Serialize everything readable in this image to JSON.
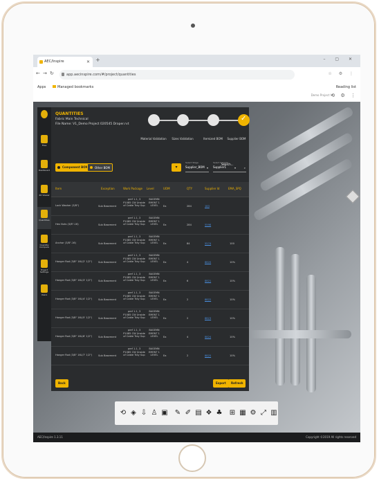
{
  "browser": {
    "tab_title": "AEC/Inspire",
    "url": "app.aecinspire.com/#/project/quantities",
    "bookmarks": {
      "apps": "Apps",
      "managed": "Managed bookmarks",
      "reading_list": "Reading list"
    }
  },
  "app": {
    "project_label": "Demo Project V1",
    "sidebar": [
      {
        "label": "Files",
        "icon": "files-icon"
      },
      {
        "label": "Dashboard",
        "icon": "dashboard-icon"
      },
      {
        "label": "2D Viewer",
        "icon": "viewer-2d-icon"
      },
      {
        "label": "Quantities",
        "icon": "quantities-icon"
      },
      {
        "label": "Quantity Compare",
        "icon": "compare-icon"
      },
      {
        "label": "Project Settings",
        "icon": "settings-icon"
      },
      {
        "label": "Users",
        "icon": "users-icon"
      }
    ],
    "status": {
      "version": "AEC/Inspire 1.3.11",
      "copyright": "Copyright ©2019  All rights reserved"
    }
  },
  "panel": {
    "title": "QUANTITIES",
    "subtitle": "Fabric Main Technical",
    "file_name": "File Name: V1_Demo Project 020545 Draper.rvt",
    "steps": [
      {
        "label": "Material Validation",
        "done": false
      },
      {
        "label": "Sizes Validation",
        "done": false
      },
      {
        "label": "Itemized BOM",
        "done": false
      },
      {
        "label": "Supplier BOM",
        "done": true
      }
    ],
    "tabs": {
      "component": "Component BOM",
      "other": "Other BOM"
    },
    "filters": [
      {
        "label": "Select Stage",
        "value": "Supplier_BOM"
      },
      {
        "label": "Select Supplier",
        "value": "Supplier1"
      },
      {
        "label": "",
        "value": "Search..."
      }
    ],
    "columns": [
      "Item",
      "Exception",
      "Work Package",
      "Level",
      "UOM",
      "QTY",
      "Supplier Id",
      "EMA_SPQ"
    ],
    "rows": [
      {
        "item": "Lock Washer (3/8\")",
        "exception": "Sub Basement",
        "wp": [
          "pref 1.1, 3",
          "P1085 CW (Inside",
          "of Cable Tray Sup"
        ],
        "level": [
          "BASEMN",
          "EMENT 1",
          "LEVEL"
        ],
        "uom": "Ea",
        "qty": "284",
        "supplier": "183",
        "spq": ""
      },
      {
        "item": "Hex Nuts (3/8\"-16)",
        "exception": "Sub Basement",
        "wp": [
          "pref 1.1, 3",
          "P1085 CW (Inside",
          "of Cable Tray Sup"
        ],
        "level": [
          "BASEMN",
          "EMENT 1",
          "LEVEL"
        ],
        "uom": "Ea",
        "qty": "284",
        "supplier": "5598",
        "spq": ""
      },
      {
        "item": "Anchor (3/8\"-16)",
        "exception": "Sub Basement",
        "wp": [
          "pref 1.1, 3",
          "P1085 CW (Inside",
          "of Cable Tray Sup"
        ],
        "level": [
          "BASEMN",
          "EMENT 1",
          "LEVEL"
        ],
        "uom": "Ea",
        "qty": "84",
        "supplier": "5574",
        "spq": "100"
      },
      {
        "item": "Hanger Rod (3/8\" 16L/2' 1/2\")",
        "exception": "Sub Basement",
        "wp": [
          "pref 1.1, 3",
          "P1085 CW (Inside",
          "of Cable Tray Sup"
        ],
        "level": [
          "BASEMN",
          "EMENT 1",
          "LEVEL"
        ],
        "uom": "Ea",
        "qty": "4",
        "supplier": "8820",
        "spq": "10%"
      },
      {
        "item": "Hanger Rod (3/8\" 16L/3' 1/2\")",
        "exception": "Sub Basement",
        "wp": [
          "pref 1.1, 3",
          "P1085 CW (Inside",
          "of Cable Tray Sup"
        ],
        "level": [
          "BASEMN",
          "EMENT 1",
          "LEVEL"
        ],
        "uom": "Ea",
        "qty": "6",
        "supplier": "8821",
        "spq": "10%"
      },
      {
        "item": "Hanger Rod (3/8\" 16L/4' 1/2\")",
        "exception": "Sub Basement",
        "wp": [
          "pref 1.1, 3",
          "P1085 CW (Inside",
          "of Cable Tray Sup"
        ],
        "level": [
          "BASEMN",
          "EMENT 1",
          "LEVEL"
        ],
        "uom": "Ea",
        "qty": "2",
        "supplier": "8822",
        "spq": "10%"
      },
      {
        "item": "Hanger Rod (3/8\" 16L/5' 1/2\")",
        "exception": "Sub Basement",
        "wp": [
          "pref 1.1, 3",
          "P1085 CW (Inside",
          "of Cable Tray Sup"
        ],
        "level": [
          "BASEMN",
          "EMENT 1",
          "LEVEL"
        ],
        "uom": "Ea",
        "qty": "2",
        "supplier": "8823",
        "spq": "10%"
      },
      {
        "item": "Hanger Rod (3/8\" 16L/6' 1/2\")",
        "exception": "Sub Basement",
        "wp": [
          "pref 1.1, 3",
          "P1085 CW (Inside",
          "of Cable Tray Sup"
        ],
        "level": [
          "BASEMN",
          "EMENT 1",
          "LEVEL"
        ],
        "uom": "Ea",
        "qty": "4",
        "supplier": "8824",
        "spq": "10%"
      },
      {
        "item": "Hanger Rod (3/8\" 16L/7' 1/2\")",
        "exception": "Sub Basement",
        "wp": [
          "pref 1.1, 3",
          "P1085 CW (Inside",
          "of Cable Tray Sup"
        ],
        "level": [
          "BASEMN",
          "EMENT 1",
          "LEVEL"
        ],
        "uom": "Ea",
        "qty": "2",
        "supplier": "8825",
        "spq": "10%"
      }
    ],
    "footer": {
      "back": "Back",
      "export": "Export",
      "refresh": "Refresh"
    }
  },
  "toolbar": {
    "tools": [
      "orbit-icon",
      "section-icon",
      "walk-icon",
      "person-icon",
      "camera-icon",
      "pen-icon",
      "markup-icon",
      "folder-icon",
      "layers-icon",
      "tree-icon",
      "hierarchy-icon",
      "properties-icon",
      "settings-icon",
      "fullscreen-icon",
      "more-icon"
    ]
  }
}
